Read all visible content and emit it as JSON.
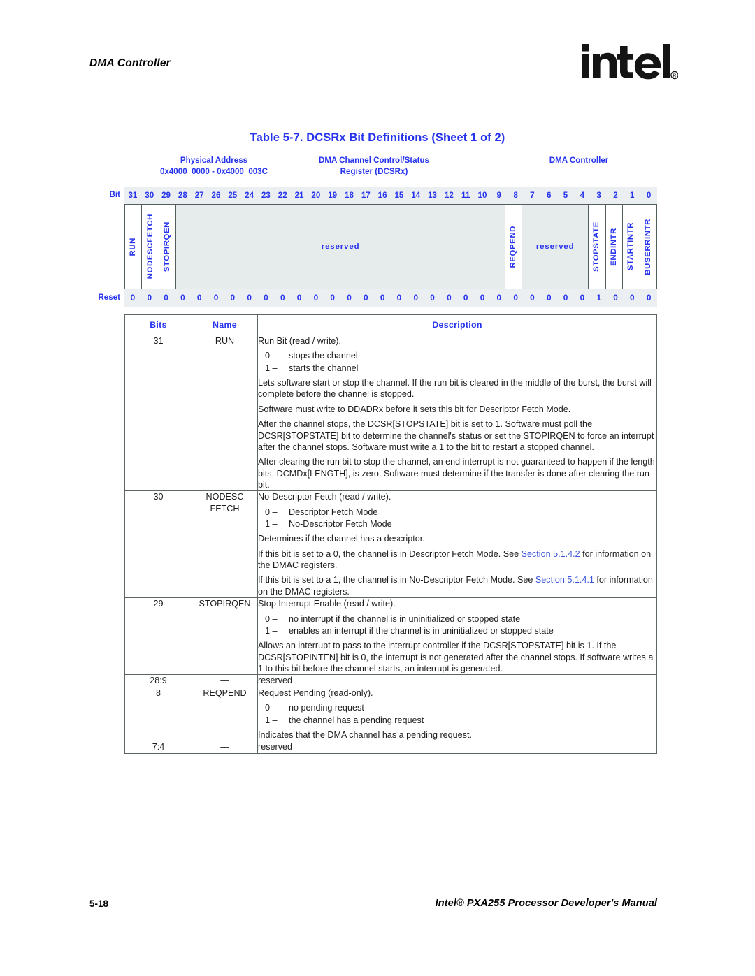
{
  "header": {
    "running_head": "DMA Controller",
    "logo_text": "intel",
    "logo_mark": "registered-trademark"
  },
  "caption": "Table 5-7. DCSRx Bit Definitions (Sheet 1 of 2)",
  "register": {
    "title_left_line1": "Physical Address",
    "title_left_line2": "0x4000_0000 - 0x4000_003C",
    "title_mid_line1": "DMA Channel Control/Status",
    "title_mid_line2": "Register (DCSRx)",
    "title_right": "DMA Controller",
    "bit_label": "Bit",
    "reset_label": "Reset",
    "bit_numbers": [
      "31",
      "30",
      "29",
      "28",
      "27",
      "26",
      "25",
      "24",
      "23",
      "22",
      "21",
      "20",
      "19",
      "18",
      "17",
      "16",
      "15",
      "14",
      "13",
      "12",
      "11",
      "10",
      "9",
      "8",
      "7",
      "6",
      "5",
      "4",
      "3",
      "2",
      "1",
      "0"
    ],
    "reset_values": [
      "0",
      "0",
      "0",
      "0",
      "0",
      "0",
      "0",
      "0",
      "0",
      "0",
      "0",
      "0",
      "0",
      "0",
      "0",
      "0",
      "0",
      "0",
      "0",
      "0",
      "0",
      "0",
      "0",
      "0",
      "0",
      "0",
      "0",
      "0",
      "1",
      "0",
      "0",
      "0"
    ],
    "fields": [
      {
        "name": "RUN",
        "span": 1,
        "orientation": "vertical",
        "style": "single"
      },
      {
        "name": "NODESCFETCH",
        "span": 1,
        "orientation": "vertical",
        "style": "single"
      },
      {
        "name": "STOPIRQEN",
        "span": 1,
        "orientation": "vertical",
        "style": "single"
      },
      {
        "name": "reserved",
        "span": 20,
        "orientation": "horizontal",
        "style": "reserved"
      },
      {
        "name": "REQPEND",
        "span": 1,
        "orientation": "vertical",
        "style": "single"
      },
      {
        "name": "reserved",
        "span": 4,
        "orientation": "horizontal",
        "style": "reserved"
      },
      {
        "name": "STOPSTATE",
        "span": 1,
        "orientation": "vertical",
        "style": "single"
      },
      {
        "name": "ENDINTR",
        "span": 1,
        "orientation": "vertical",
        "style": "single"
      },
      {
        "name": "STARTINTR",
        "span": 1,
        "orientation": "vertical",
        "style": "single"
      },
      {
        "name": "BUSERRINTR",
        "span": 1,
        "orientation": "vertical",
        "style": "single"
      }
    ]
  },
  "table": {
    "columns": [
      "Bits",
      "Name",
      "Description"
    ],
    "rows": [
      {
        "bits": "31",
        "name": "RUN",
        "lead": "Run Bit (read / write).",
        "options": [
          {
            "key": "0 –",
            "text": "stops the channel"
          },
          {
            "key": "1 –",
            "text": "starts the channel"
          }
        ],
        "paras": [
          "Lets software start or stop the channel. If the run bit is cleared in the middle of the burst, the burst will complete before the channel is stopped.",
          "Software must write to DDADRx before it sets this bit for Descriptor Fetch Mode.",
          "After the channel stops, the DCSR[STOPSTATE] bit is set to 1. Software must poll the DCSR[STOPSTATE] bit to determine the channel's status or set the STOPIRQEN to force an interrupt after the channel stops. Software must write a 1 to the bit to restart a stopped channel.",
          "After clearing the run bit to stop the channel, an end interrupt is not guaranteed to happen if the length bits, DCMDx[LENGTH], is zero. Software must determine if the transfer is done after clearing the run bit."
        ]
      },
      {
        "bits": "30",
        "name": "NODESC\nFETCH",
        "name_line1": "NODESC",
        "name_line2": "FETCH",
        "lead": "No-Descriptor Fetch (read / write).",
        "options": [
          {
            "key": "0 –",
            "text": "Descriptor Fetch Mode"
          },
          {
            "key": "1 –",
            "text": "No-Descriptor Fetch Mode"
          }
        ],
        "paras": [
          "Determines if the channel has a descriptor."
        ],
        "link_paras": [
          {
            "before": "If this bit is set to a 0, the channel is in Descriptor Fetch Mode. See ",
            "link": "Section 5.1.4.2",
            "after": " for information on the DMAC registers."
          },
          {
            "before": "If this bit is set to a 1, the channel is in No-Descriptor Fetch Mode. See ",
            "link": "Section 5.1.4.1",
            "after": " for information on the DMAC registers."
          }
        ]
      },
      {
        "bits": "29",
        "name": "STOPIRQEN",
        "lead": "Stop Interrupt Enable (read / write).",
        "options": [
          {
            "key": "0 –",
            "text": "no interrupt if the channel is in uninitialized or stopped state"
          },
          {
            "key": "1 –",
            "text": "enables an interrupt if the channel is in uninitialized or stopped state"
          }
        ],
        "paras": [
          "Allows an interrupt to pass to the interrupt controller if the DCSR[STOPSTATE] bit is 1. If the DCSR[STOPINTEN] bit is 0, the interrupt is not generated after the channel stops. If software writes a 1 to this bit before the channel starts, an interrupt is generated."
        ]
      },
      {
        "bits": "28:9",
        "name": "—",
        "reserved_text": "reserved"
      },
      {
        "bits": "8",
        "name": "REQPEND",
        "lead": "Request Pending (read-only).",
        "options": [
          {
            "key": "0 –",
            "text": "no pending request"
          },
          {
            "key": "1 –",
            "text": "the channel has a pending request"
          }
        ],
        "paras": [
          "Indicates that the DMA channel has a pending request."
        ]
      },
      {
        "bits": "7:4",
        "name": "—",
        "reserved_text": "reserved"
      }
    ]
  },
  "footer": {
    "page_number": "5-18",
    "manual_title": "Intel® PXA255 Processor Developer's Manual"
  },
  "colors": {
    "heading_blue": "#2633ed",
    "link_blue": "#3a53d8",
    "reserved_fill": "#e6ebec",
    "strip_fill": "#ebeff1",
    "border": "#5d6566"
  }
}
